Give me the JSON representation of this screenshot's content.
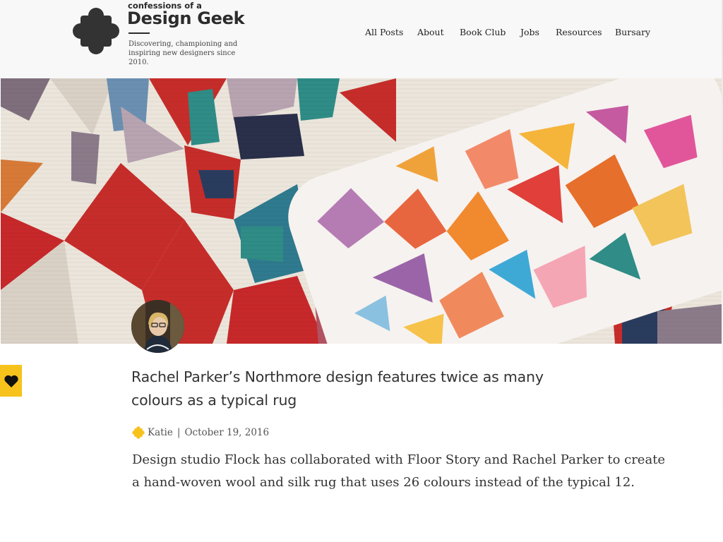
{
  "brand": {
    "kicker": "confessions of a",
    "name": "Design Geek",
    "tagline_line1": "Discovering, championing and",
    "tagline_line2": "inspiring new designers since 2010.",
    "color": "#333333"
  },
  "nav": {
    "items": [
      "All Posts",
      "About",
      "Book Club",
      "Jobs",
      "Resources",
      "Bursary"
    ]
  },
  "hero": {
    "subject": "geometric patterned rug with a printed cushion"
  },
  "favorite": {
    "icon": "heart-icon",
    "color": "#F7C21C"
  },
  "post": {
    "title": "Rachel Parker’s Northmore design features twice as many colours as a typical rug",
    "author": "Katie",
    "separator": "|",
    "date": "October 19, 2016",
    "excerpt": "Design studio Flock has collaborated with Floor Story and Rachel Parker to create a hand-woven wool and silk rug that uses 26 colours instead of the typical 12.",
    "author_icon": "cross-logo-icon",
    "accent_color": "#F7C21C"
  }
}
